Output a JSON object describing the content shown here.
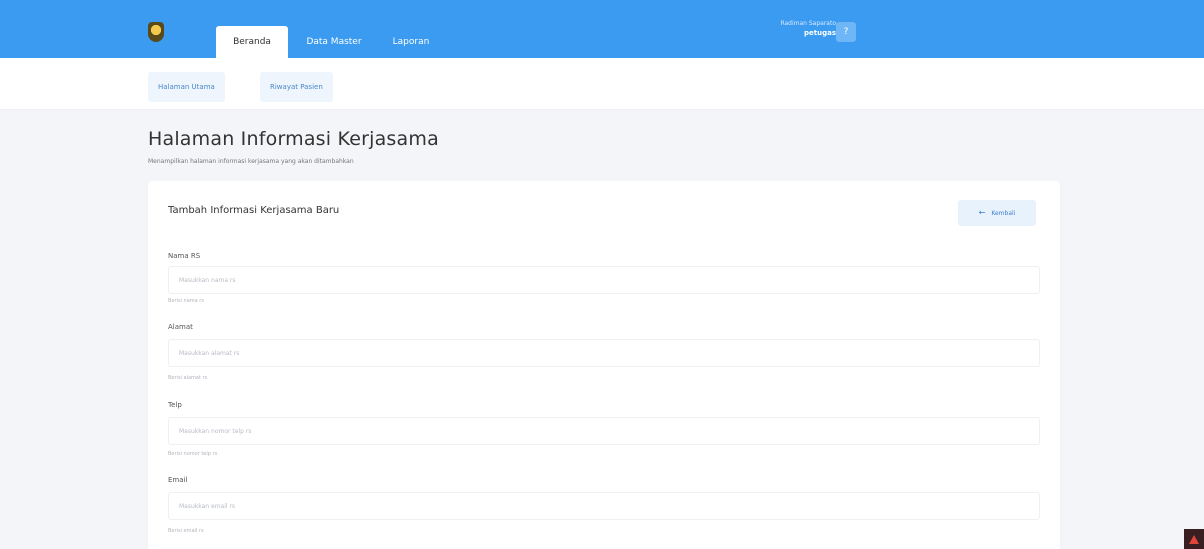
{
  "navbar": {
    "tabs": [
      {
        "label": "Beranda",
        "active": true
      },
      {
        "label": "Data Master",
        "active": false
      },
      {
        "label": "Laporan",
        "active": false
      }
    ],
    "user": {
      "name": "Radiman Saparato",
      "role": "petugas"
    },
    "avatar_glyph": "?",
    "color": "#3b9bf1"
  },
  "subnav": {
    "items": [
      {
        "label": "Halaman Utama"
      },
      {
        "label": "Riwayat Pasien"
      }
    ]
  },
  "page": {
    "title": "Halaman Informasi Kerjasama",
    "subtitle": "Menampilkan halaman informasi kerjasama yang akan ditambahkan"
  },
  "card": {
    "title": "Tambah Informasi Kerjasama Baru",
    "back_label": "Kembali",
    "back_icon": "arrow-left-icon",
    "fields": [
      {
        "label": "Nama RS",
        "placeholder": "Masukkan nama rs",
        "help": "Berisi nama rs"
      },
      {
        "label": "Alamat",
        "placeholder": "Masukkan alamat rs",
        "help": "Berisi alamat rs"
      },
      {
        "label": "Telp",
        "placeholder": "Masukkan nomor telp rs",
        "help": "Berisi nomor telp rs"
      },
      {
        "label": "Email",
        "placeholder": "Masukkan email rs",
        "help": "Berisi email rs"
      }
    ]
  }
}
